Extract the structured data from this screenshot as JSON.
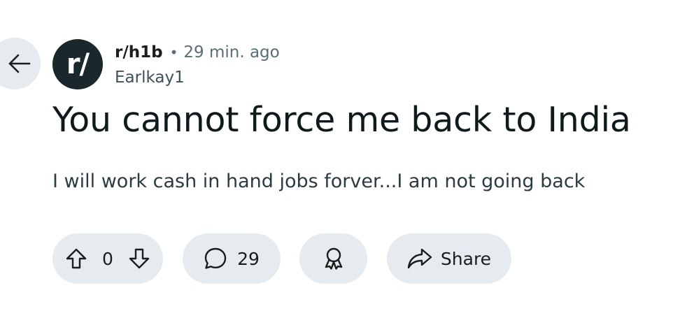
{
  "header": {
    "subreddit": "r/h1b",
    "separator": "•",
    "time_ago": "29 min. ago",
    "author": "Earlkay1",
    "avatar_text": "r/"
  },
  "post": {
    "title": "You cannot force me back to India",
    "body": "I will work cash in hand jobs forver...I am not going back"
  },
  "actions": {
    "vote_count": "0",
    "comment_count": "29",
    "share_label": "Share"
  },
  "icons": {
    "back": "arrow-left-icon",
    "upvote": "upvote-arrow-icon",
    "downvote": "downvote-arrow-icon",
    "comment": "speech-bubble-icon",
    "award": "award-ribbon-icon",
    "share": "share-arrow-icon"
  },
  "colors": {
    "pill_background": "#e5ebee",
    "avatar_background": "#1a282d",
    "muted_text": "#576f76"
  }
}
